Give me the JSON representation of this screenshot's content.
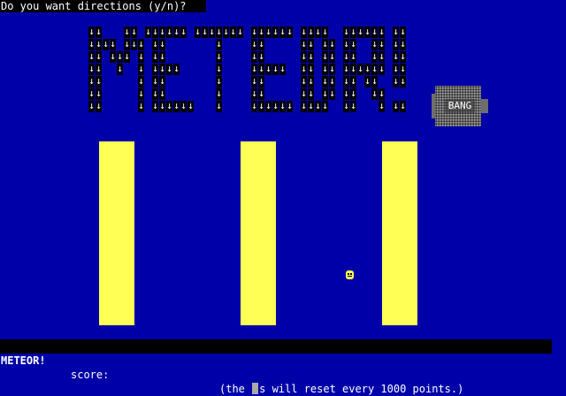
{
  "prompt": {
    "text": "Do you want directions (y/n)?"
  },
  "logo": {
    "title": "METEOR!",
    "glyph": "↓",
    "rows": [
      "##   ## ###### ####### ###### ####  ###### ##",
      "#### ### ##       #    ##     ## ## ##  ## ##",
      "## ### # ##       #    ##     ## ## ##  ## ##",
      "##  #  # ####     #    #####  ## ## ###### ##",
      "##     # ##       #    ##     ## ## ## ##  ##",
      "##     # ##       #    ##     ## ## ##  ##   ",
      "##     # ######   #    ###### ####  ##   # ##"
    ],
    "color_cell": "#000000",
    "color_glyph": "#ffffff"
  },
  "explosion": {
    "label": "BANG",
    "color": "#6e6e6e"
  },
  "status": {
    "title": "METEOR!",
    "score_label": "score:",
    "note_before": "(the ",
    "note_after": "s will reset every 1000 points.)"
  },
  "colors": {
    "background": "#0000a8",
    "pillar": "#ffff55",
    "bar": "#000000",
    "text": "#ffffff"
  }
}
